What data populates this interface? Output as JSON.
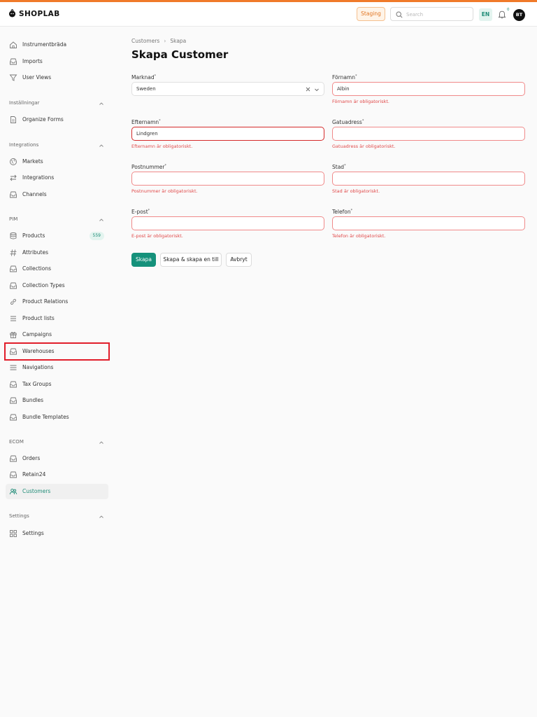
{
  "header": {
    "logo_text": "SHOPLAB",
    "env_badge": "Staging",
    "search_placeholder": "Search",
    "language": "EN",
    "notifications_count": "0",
    "avatar_initials": "BT"
  },
  "sidebar": {
    "top_items": [
      {
        "label": "Instrumentbräda",
        "icon": "home-icon"
      },
      {
        "label": "Imports",
        "icon": "inbox-icon"
      },
      {
        "label": "User Views",
        "icon": "filter-icon"
      }
    ],
    "sections": [
      {
        "title": "Inställningar",
        "items": [
          {
            "label": "Organize Forms",
            "icon": "document-icon"
          }
        ]
      },
      {
        "title": "Integrations",
        "items": [
          {
            "label": "Markets",
            "icon": "globe-icon"
          },
          {
            "label": "Integrations",
            "icon": "arrows-icon"
          },
          {
            "label": "Channels",
            "icon": "inbox-icon"
          }
        ]
      },
      {
        "title": "PIM",
        "items": [
          {
            "label": "Products",
            "icon": "database-icon",
            "badge": "559"
          },
          {
            "label": "Attributes",
            "icon": "hash-icon"
          },
          {
            "label": "Collections",
            "icon": "inbox-icon"
          },
          {
            "label": "Collection Types",
            "icon": "inbox-icon"
          },
          {
            "label": "Product Relations",
            "icon": "link-icon"
          },
          {
            "label": "Product lists",
            "icon": "list-icon"
          },
          {
            "label": "Campaigns",
            "icon": "gift-icon"
          },
          {
            "label": "Warehouses",
            "icon": "inbox-icon"
          },
          {
            "label": "Navigations",
            "icon": "menu-icon"
          },
          {
            "label": "Tax Groups",
            "icon": "inbox-icon"
          },
          {
            "label": "Bundles",
            "icon": "inbox-icon"
          },
          {
            "label": "Bundle Templates",
            "icon": "inbox-icon"
          }
        ]
      },
      {
        "title": "ECOM",
        "items": [
          {
            "label": "Orders",
            "icon": "inbox-icon"
          },
          {
            "label": "Retain24",
            "icon": "inbox-icon"
          },
          {
            "label": "Customers",
            "icon": "users-icon"
          }
        ]
      },
      {
        "title": "Settings",
        "items": [
          {
            "label": "Settings",
            "icon": "grid-icon"
          }
        ]
      }
    ]
  },
  "main": {
    "breadcrumb": [
      "Customers",
      "Skapa"
    ],
    "title": "Skapa Customer",
    "required_mark": "*",
    "fields": {
      "marknad": {
        "label": "Marknad",
        "value": "Sweden"
      },
      "fornamn": {
        "label": "Förnamn",
        "value": "Albin",
        "error": "Förnamn är obligatoriskt."
      },
      "efternamn": {
        "label": "Efternamn",
        "value": "Lindgren",
        "error": "Efternamn är obligatoriskt."
      },
      "gatuadress": {
        "label": "Gatuadress",
        "value": "",
        "error": "Gatuadress är obligatoriskt."
      },
      "postnummer": {
        "label": "Postnummer",
        "value": "",
        "error": "Postnummer är obligatoriskt."
      },
      "stad": {
        "label": "Stad",
        "value": "",
        "error": "Stad är obligatoriskt."
      },
      "epost": {
        "label": "E-post",
        "value": "",
        "error": "E-post är obligatoriskt."
      },
      "telefon": {
        "label": "Telefon",
        "value": "",
        "error": "Telefon är obligatoriskt."
      }
    },
    "buttons": {
      "create": "Skapa",
      "create_another": "Skapa & skapa en till",
      "cancel": "Avbryt"
    }
  },
  "colors": {
    "accent": "#15917b",
    "error": "#e04848",
    "highlight": "#e11d2a",
    "top_stripe": "#f07a2a"
  }
}
